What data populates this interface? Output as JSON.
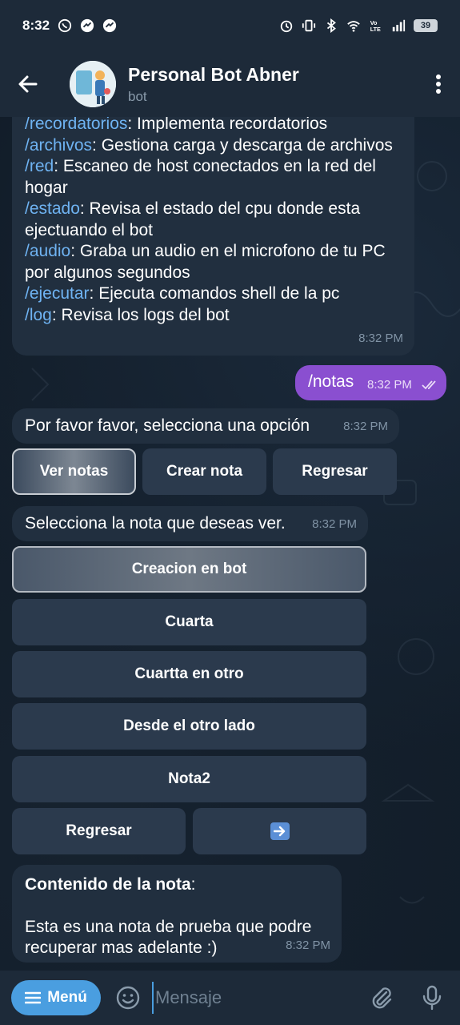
{
  "status_bar": {
    "time": "8:32",
    "battery": "39",
    "app_icons": [
      "whatsapp-icon",
      "messenger-icon",
      "messenger-icon"
    ],
    "system_icons": [
      "alarm-icon",
      "vibrate-icon",
      "bluetooth-icon",
      "wifi-icon",
      "volte-icon",
      "signal-icon",
      "battery-icon"
    ]
  },
  "header": {
    "title": "Personal Bot Abner",
    "subtitle": "bot"
  },
  "messages": {
    "commands": [
      {
        "cmd": "/recordatorios",
        "desc": ": Implementa recordatorios"
      },
      {
        "cmd": "/archivos",
        "desc": ": Gestiona carga y descarga de archivos"
      },
      {
        "cmd": "/red",
        "desc": ": Escaneo de host conectados en la red del hogar"
      },
      {
        "cmd": "/estado",
        "desc": ": Revisa el estado del cpu donde esta ejectuando el bot"
      },
      {
        "cmd": "/audio",
        "desc": ": Graba un audio en el microfono de tu PC por algunos segundos"
      },
      {
        "cmd": "/ejecutar",
        "desc": ": Ejecuta comandos shell de la pc"
      },
      {
        "cmd": "/log",
        "desc": ": Revisa los logs del bot"
      }
    ],
    "commands_time": "8:32 PM",
    "outgoing_text": "/notas",
    "outgoing_time": "8:32 PM",
    "prompt1_text": "Por favor favor, selecciona una opción",
    "prompt1_time": "8:32 PM",
    "keyboard1": [
      "Ver notas",
      "Crear nota",
      "Regresar"
    ],
    "prompt2_text": "Selecciona la nota que deseas ver.",
    "prompt2_time": "8:32 PM",
    "keyboard2": [
      "Creacion en bot",
      "Cuarta",
      "Cuartta en otro",
      "Desde el otro lado",
      "Nota2"
    ],
    "keyboard2_back": "Regresar",
    "keyboard2_next": "➡️",
    "note_title": "Contenido de la nota",
    "note_colon": ":",
    "note_body_line1": "Esta es una nota de prueba que podre",
    "note_body_line2": "recuperar mas adelante  :)",
    "note_time": "8:32 PM"
  },
  "input_bar": {
    "menu_label": "Menú",
    "placeholder": "Mensaje"
  },
  "colors": {
    "accent": "#4a9ee0",
    "outgoing_bubble": "#8a4fd0",
    "command_link": "#6fb3f2"
  }
}
